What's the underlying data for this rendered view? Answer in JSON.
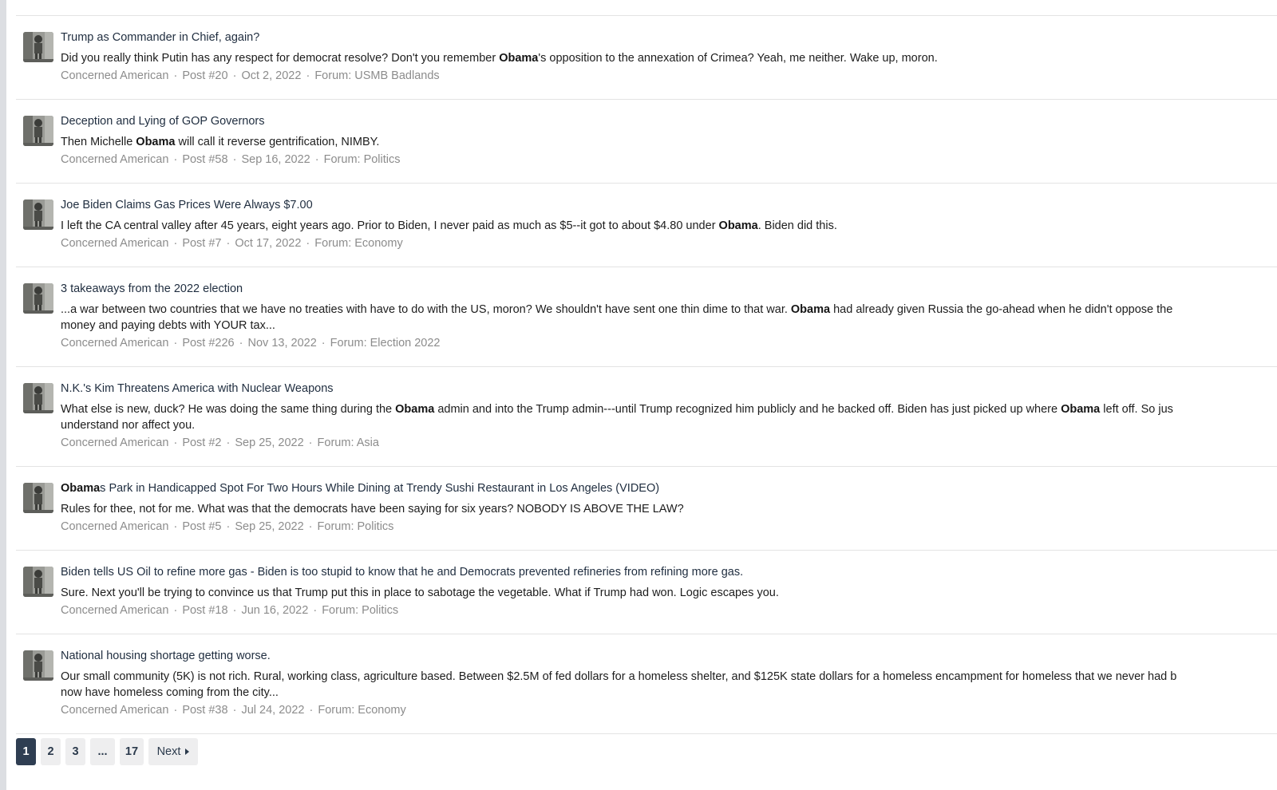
{
  "results": [
    {
      "title": "Trump as Commander in Chief, again?",
      "snippet": [
        {
          "t": "Did you really think Putin has any respect for democrat resolve? Don't you remember "
        },
        {
          "t": "Obama",
          "b": true
        },
        {
          "t": "'s opposition to the annexation of Crimea? Yeah, me neither. Wake up, moron."
        }
      ],
      "author": "Concerned American",
      "post": "Post #20",
      "date": "Oct 2, 2022",
      "forum": "Forum: USMB Badlands"
    },
    {
      "title": "Deception and Lying of GOP Governors",
      "snippet": [
        {
          "t": "Then Michelle "
        },
        {
          "t": "Obama",
          "b": true
        },
        {
          "t": " will call it reverse gentrification, NIMBY."
        }
      ],
      "author": "Concerned American",
      "post": "Post #58",
      "date": "Sep 16, 2022",
      "forum": "Forum: Politics"
    },
    {
      "title": "Joe Biden Claims Gas Prices Were Always $7.00",
      "snippet": [
        {
          "t": "I left the CA central valley after 45 years, eight years ago. Prior to Biden, I never paid as much as $5--it got to about $4.80 under "
        },
        {
          "t": "Obama",
          "b": true
        },
        {
          "t": ". Biden did this."
        }
      ],
      "author": "Concerned American",
      "post": "Post #7",
      "date": "Oct 17, 2022",
      "forum": "Forum: Economy"
    },
    {
      "title": "3 takeaways from the 2022 election",
      "snippet": [
        {
          "t": "...a war between two countries that we have no treaties with have to do with the US, moron? We shouldn't have sent one thin dime to that war. "
        },
        {
          "t": "Obama",
          "b": true
        },
        {
          "t": " had already given Russia the go-ahead when he didn't oppose the"
        },
        {
          "br": true
        },
        {
          "t": "money and paying debts with YOUR tax..."
        }
      ],
      "author": "Concerned American",
      "post": "Post #226",
      "date": "Nov 13, 2022",
      "forum": "Forum: Election 2022"
    },
    {
      "title": "N.K.'s Kim Threatens America with Nuclear Weapons",
      "snippet": [
        {
          "t": "What else is new, duck? He was doing the same thing during the "
        },
        {
          "t": "Obama",
          "b": true
        },
        {
          "t": " admin and into the Trump admin---until Trump recognized him publicly and he backed off. Biden has just picked up where "
        },
        {
          "t": "Obama",
          "b": true
        },
        {
          "t": " left off. So jus"
        },
        {
          "br": true
        },
        {
          "t": "understand nor affect you."
        }
      ],
      "author": "Concerned American",
      "post": "Post #2",
      "date": "Sep 25, 2022",
      "forum": "Forum: Asia"
    },
    {
      "title_parts": [
        {
          "t": "Obama",
          "b": true
        },
        {
          "t": "s Park in Handicapped Spot For Two Hours While Dining at Trendy Sushi Restaurant in Los Angeles (VIDEO)"
        }
      ],
      "snippet": [
        {
          "t": "Rules for thee, not for me. What was that the democrats have been saying for six years? NOBODY IS ABOVE THE LAW?"
        }
      ],
      "author": "Concerned American",
      "post": "Post #5",
      "date": "Sep 25, 2022",
      "forum": "Forum: Politics"
    },
    {
      "title": "Biden tells US Oil to refine more gas - Biden is too stupid to know that he and Democrats prevented refineries from refining more gas.",
      "snippet": [
        {
          "t": "Sure. Next you'll be trying to convince us that Trump put this in place to sabotage the vegetable. What if Trump had won. Logic escapes you."
        }
      ],
      "author": "Concerned American",
      "post": "Post #18",
      "date": "Jun 16, 2022",
      "forum": "Forum: Politics"
    },
    {
      "title": "National housing shortage getting worse.",
      "snippet": [
        {
          "t": "Our small community (5K) is not rich. Rural, working class, agriculture based. Between $2.5M of fed dollars for a homeless shelter, and $125K state dollars for a homeless encampment for homeless that we never had b"
        },
        {
          "br": true
        },
        {
          "t": "now have homeless coming from the city..."
        }
      ],
      "author": "Concerned American",
      "post": "Post #38",
      "date": "Jul 24, 2022",
      "forum": "Forum: Economy"
    }
  ],
  "pagination": {
    "pages": [
      "1",
      "2",
      "3",
      "...",
      "17"
    ],
    "current": "1",
    "next_label": "Next"
  },
  "meta_separator": "·",
  "icons": {
    "avatar": "user-avatar-icon",
    "next": "caret-right-icon"
  },
  "colors": {
    "title": "#1f2d3f",
    "meta": "#8c8c8c",
    "current_page_bg": "#2f3e52",
    "page_bg": "#eeeeef"
  }
}
